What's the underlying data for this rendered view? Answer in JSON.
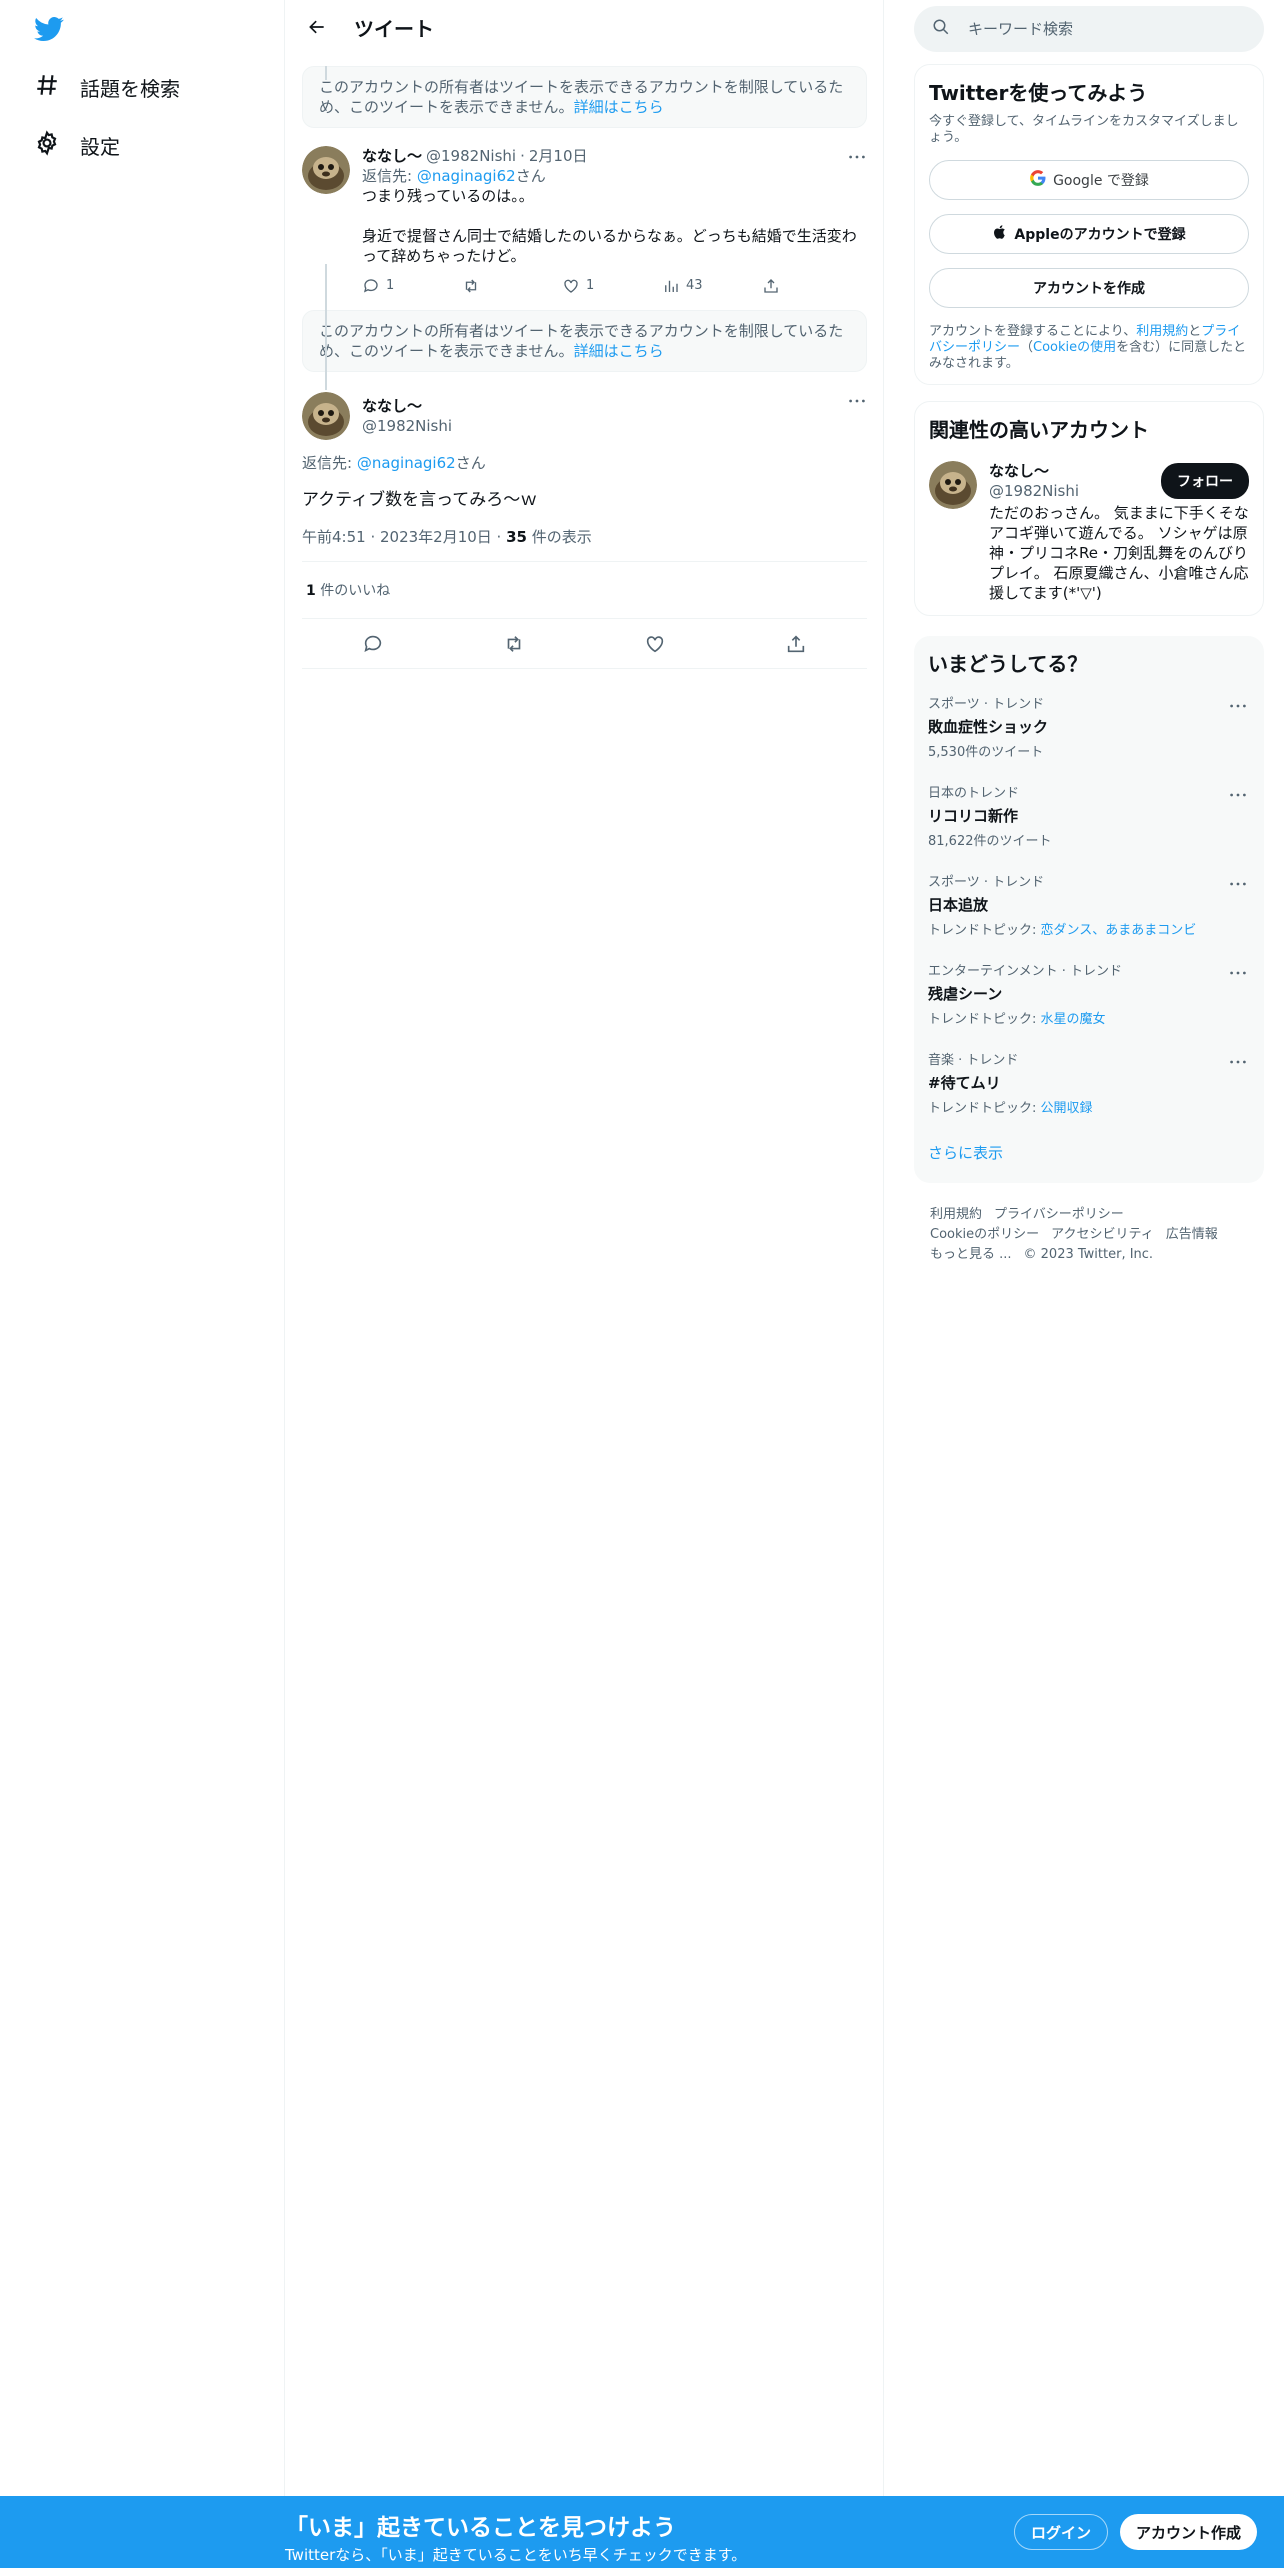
{
  "colors": {
    "accent": "#1d9bf0",
    "text": "#0f1419",
    "muted": "#536471",
    "bottom_bar": "#1d9bf0"
  },
  "sidebar": {
    "logo": "twitter-bird-icon",
    "items": [
      {
        "label": "話題を検索",
        "icon": "hashtag-icon"
      },
      {
        "label": "設定",
        "icon": "gear-icon"
      }
    ]
  },
  "header": {
    "title": "ツイート"
  },
  "restricted_notice": {
    "text": "このアカウントの所有者はツイートを表示できるアカウントを制限しているため、このツイートを表示できません。",
    "link": "詳細はこちら"
  },
  "reply_tweet": {
    "name": "ななし～",
    "handle": "@1982Nishi",
    "sep": "·",
    "date": "2月10日",
    "reply_prefix": "返信先: ",
    "reply_to": "@naginagi62",
    "reply_suffix": "さん",
    "line1": "つまり残っているのは。。",
    "line2": "身近で提督さん同士で結婚したのいるからなぁ。どっちも結婚で生活変わって辞めちゃったけど。",
    "replies": "1",
    "retweets": "",
    "likes": "1",
    "views": "43"
  },
  "main_tweet": {
    "name": "ななし～",
    "handle": "@1982Nishi",
    "reply_prefix": "返信先: ",
    "reply_to": "@naginagi62",
    "reply_suffix": "さん",
    "text": "アクティブ数を言ってみろ～ｗ",
    "time": "午前4:51 · 2023年2月10日 · ",
    "views_count": "35",
    "views_label": " 件の表示",
    "likes_count": "1",
    "likes_label": " 件のいいね"
  },
  "search": {
    "placeholder": "キーワード検索"
  },
  "signup_card": {
    "title": "Twitterを使ってみよう",
    "subtitle": "今すぐ登録して、タイムラインをカスタマイズしましょう。",
    "google_button": "Google で登録",
    "apple_button": "Appleのアカウントで登録",
    "create_button": "アカウントを作成",
    "terms_prefix": "アカウントを登録することにより、",
    "terms_link": "利用規約",
    "terms_and": "と",
    "privacy_link": "プライバシーポリシー",
    "cookie_prefix": "（",
    "cookie_link": "Cookieの使用",
    "terms_suffix": "を含む）に同意したとみなされます。"
  },
  "related_card": {
    "title": "関連性の高いアカウント",
    "name": "ななし～",
    "handle": "@1982Nishi",
    "follow_button": "フォロー",
    "bio": "ただのおっさん。 気ままに下手くそなアコギ弾いて遊んでる。 ソシャゲは原神・プリコネRe・刀剣乱舞をのんびりプレイ。 石原夏織さん、小倉唯さん応援してます(*'▽')"
  },
  "trends_card": {
    "title": "いまどうしてる？",
    "items": [
      {
        "category": "スポーツ · トレンド",
        "name": "敗血症性ショック",
        "sub_prefix": "5,530件のツイート",
        "sub_link": ""
      },
      {
        "category": "日本のトレンド",
        "name": "リコリコ新作",
        "sub_prefix": "81,622件のツイート",
        "sub_link": ""
      },
      {
        "category": "スポーツ · トレンド",
        "name": "日本追放",
        "sub_prefix": "トレンドトピック: ",
        "sub_link": "恋ダンス、あまあまコンビ"
      },
      {
        "category": "エンターテインメント · トレンド",
        "name": "残虐シーン",
        "sub_prefix": "トレンドトピック: ",
        "sub_link": "水星の魔女"
      },
      {
        "category": "音楽 · トレンド",
        "name": "#待てムリ",
        "sub_prefix": "トレンドトピック: ",
        "sub_link": "公開収録"
      }
    ],
    "show_more": "さらに表示"
  },
  "footer": {
    "links": [
      "利用規約",
      "プライバシーポリシー",
      "Cookieのポリシー",
      "アクセシビリティ",
      "広告情報",
      "もっと見る ..."
    ],
    "copyright": "© 2023 Twitter, Inc."
  },
  "bottom_bar": {
    "title": "「いま」起きていることを見つけよう",
    "subtitle": "Twitterなら、「いま」起きていることをいち早くチェックできます。",
    "login": "ログイン",
    "signup": "アカウント作成"
  }
}
